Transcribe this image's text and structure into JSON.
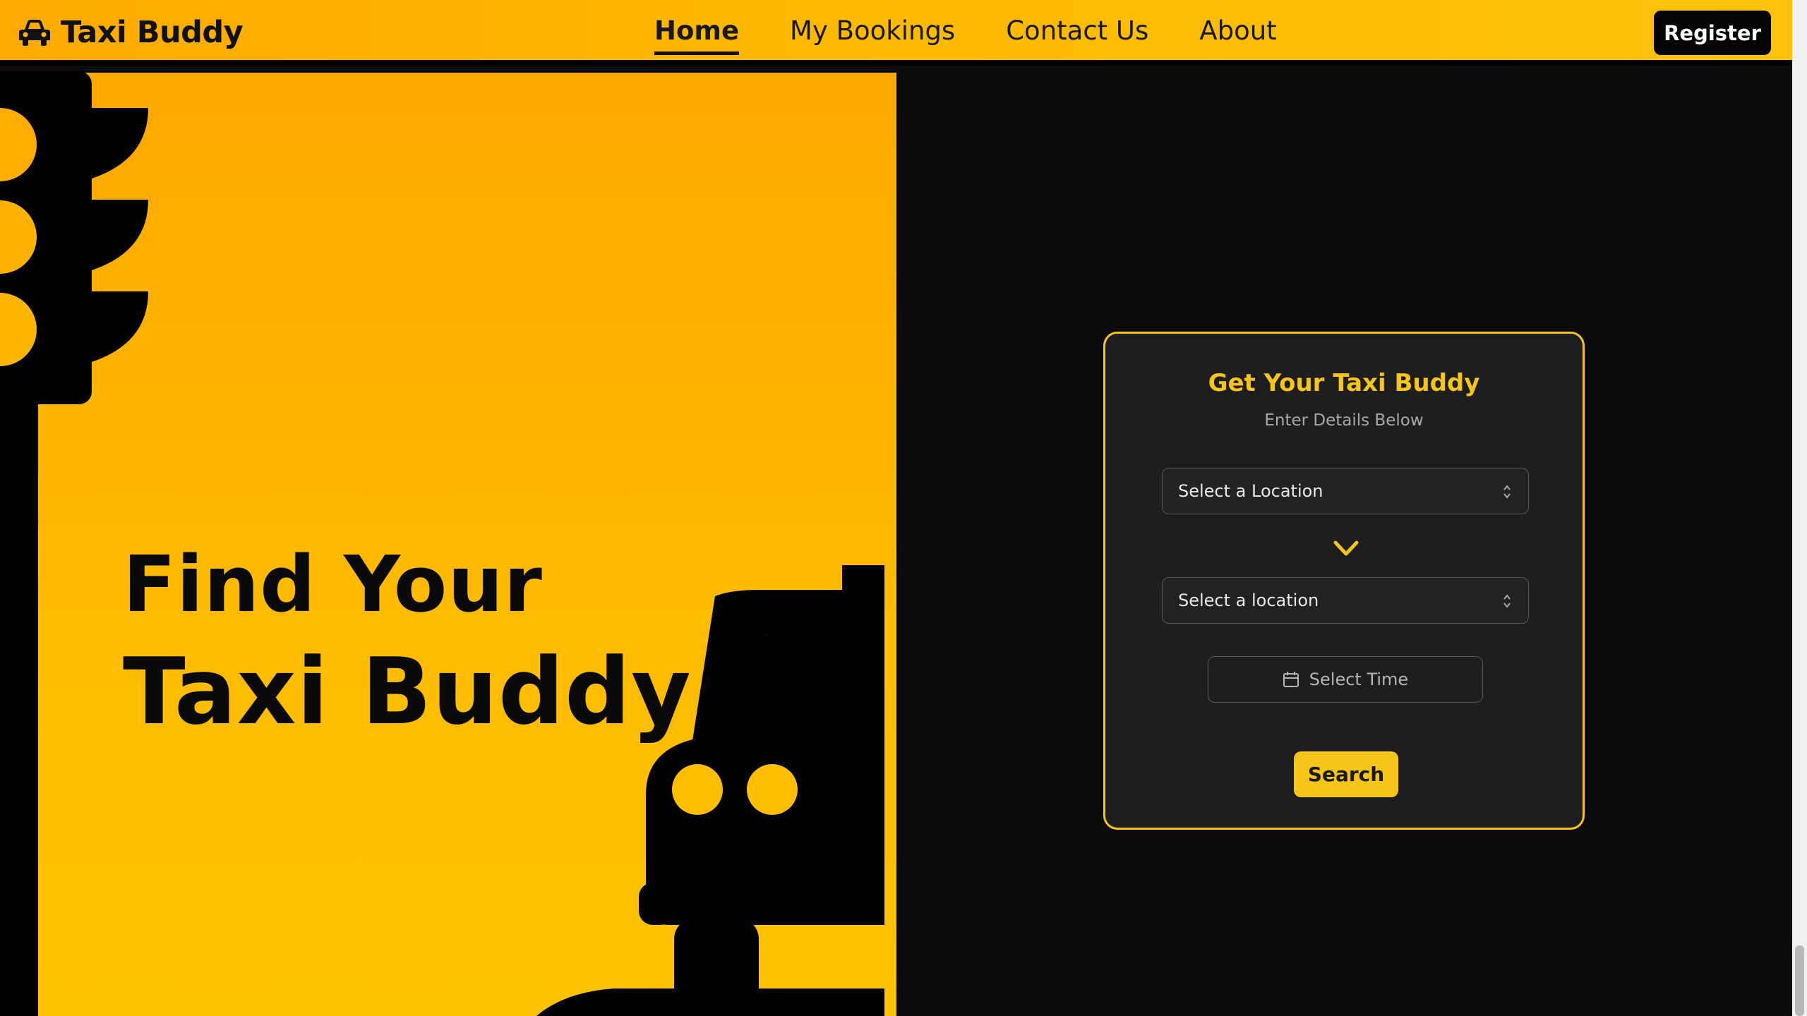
{
  "header": {
    "brand_name": "Taxi Buddy",
    "brand_icon": "car-icon",
    "nav": [
      {
        "label": "Home",
        "active": true
      },
      {
        "label": "My Bookings",
        "active": false
      },
      {
        "label": "Contact Us",
        "active": false
      },
      {
        "label": "About",
        "active": false
      }
    ],
    "register_label": "Register"
  },
  "hero": {
    "line1": "Find Your",
    "line2": "Taxi Buddy"
  },
  "form": {
    "title": "Get Your Taxi Buddy",
    "subtitle": "Enter Details Below",
    "from_select": {
      "value": "Select a Location"
    },
    "to_select": {
      "value": "Select a location"
    },
    "swap_icon": "chevron-down-icon",
    "time_icon": "calendar-icon",
    "time_label": "Select Time",
    "search_label": "Search"
  },
  "colors": {
    "accent": "#f5c518",
    "header_start": "#ffaa00",
    "header_end": "#ffc20a",
    "background": "#0b0b0b",
    "card": "#1e1e1e"
  }
}
